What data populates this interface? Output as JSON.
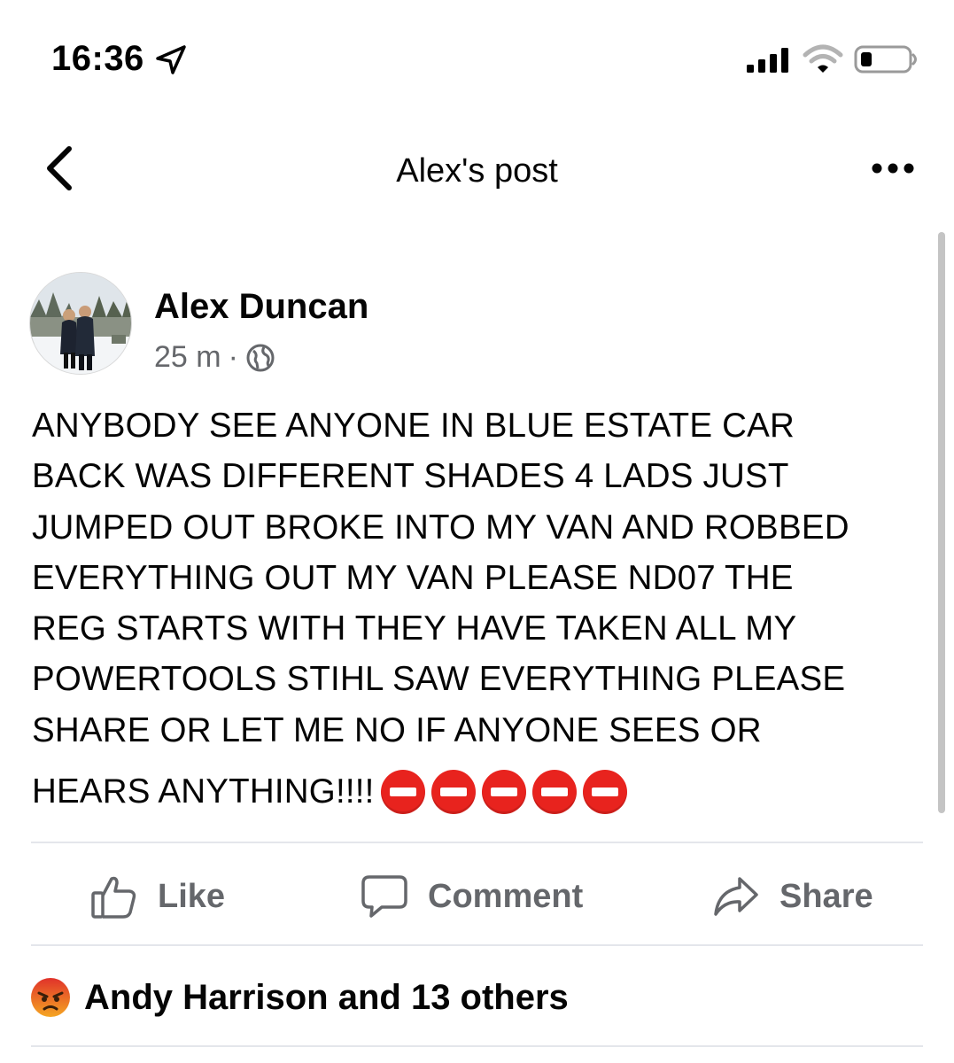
{
  "status_bar": {
    "time": "16:36"
  },
  "header": {
    "title": "Alex's post"
  },
  "post": {
    "author": "Alex Duncan",
    "time_ago": "25 m",
    "separator": "·",
    "text_lines": [
      "ANYBODY SEE ANYONE IN BLUE ESTATE CAR",
      "BACK WAS DIFFERENT SHADES 4 LADS JUST",
      "JUMPED OUT BROKE INTO MY VAN AND ROBBED",
      "EVERYTHING OUT MY VAN PLEASE ND07 THE",
      "REG STARTS WITH THEY HAVE TAKEN ALL MY",
      "POWERTOOLS STIHL SAW EVERYTHING PLEASE",
      "SHARE OR LET ME NO IF ANYONE SEES OR",
      "HEARS ANYTHING!!!!"
    ],
    "emoji": [
      "no-entry-icon",
      "no-entry-icon",
      "no-entry-icon",
      "no-entry-icon",
      "no-entry-icon"
    ]
  },
  "actions": {
    "like": "Like",
    "comment": "Comment",
    "share": "Share"
  },
  "reactions": {
    "icon": "angry-face-icon",
    "summary": "Andy Harrison and 13 others"
  },
  "colors": {
    "text_primary": "#050505",
    "text_secondary": "#65676b",
    "divider": "#e4e6eb",
    "no_entry_red": "#e8231e",
    "angry_orange": "#e9710f"
  }
}
